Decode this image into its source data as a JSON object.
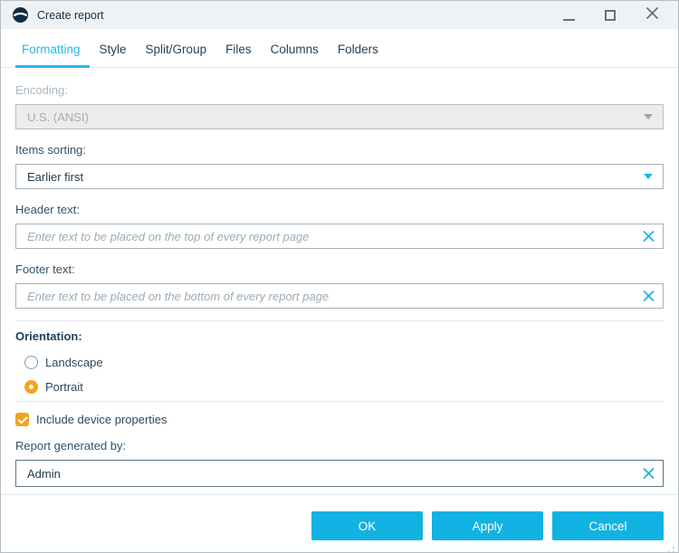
{
  "window": {
    "title": "Create report"
  },
  "icons": {
    "app": "app-logo-icon",
    "minimize": "minimize-icon",
    "maximize": "maximize-icon",
    "close": "close-icon",
    "dropdown": "chevron-down-icon",
    "clear": "clear-x-icon",
    "resize": "resize-grip-icon"
  },
  "tabs": [
    {
      "label": "Formatting",
      "active": true
    },
    {
      "label": "Style",
      "active": false
    },
    {
      "label": "Split/Group",
      "active": false
    },
    {
      "label": "Files",
      "active": false
    },
    {
      "label": "Columns",
      "active": false
    },
    {
      "label": "Folders",
      "active": false
    }
  ],
  "form": {
    "encoding": {
      "label": "Encoding:",
      "value": "U.S. (ANSI)",
      "disabled": true
    },
    "items_sorting": {
      "label": "Items sorting:",
      "value": "Earlier first"
    },
    "header_text": {
      "label": "Header text:",
      "value": "",
      "placeholder": "Enter text to be placed on the top of every report page"
    },
    "footer_text": {
      "label": "Footer text:",
      "value": "",
      "placeholder": "Enter text to be placed on the bottom of every report page"
    },
    "orientation": {
      "label": "Orientation:",
      "options": [
        {
          "label": "Landscape",
          "selected": false
        },
        {
          "label": "Portrait",
          "selected": true
        }
      ]
    },
    "include_device_properties": {
      "label": "Include device properties",
      "checked": true
    },
    "report_generated_by": {
      "label": "Report generated by:",
      "value": "Admin"
    }
  },
  "buttons": {
    "ok": "OK",
    "apply": "Apply",
    "cancel": "Cancel"
  },
  "colors": {
    "accent": "#12b2e2",
    "active_tab": "#29b7e8",
    "orange": "#f5a31d",
    "titlebar_bg": "#eef2f4",
    "label_text": "#33536a",
    "disabled_bg": "#ececec"
  }
}
